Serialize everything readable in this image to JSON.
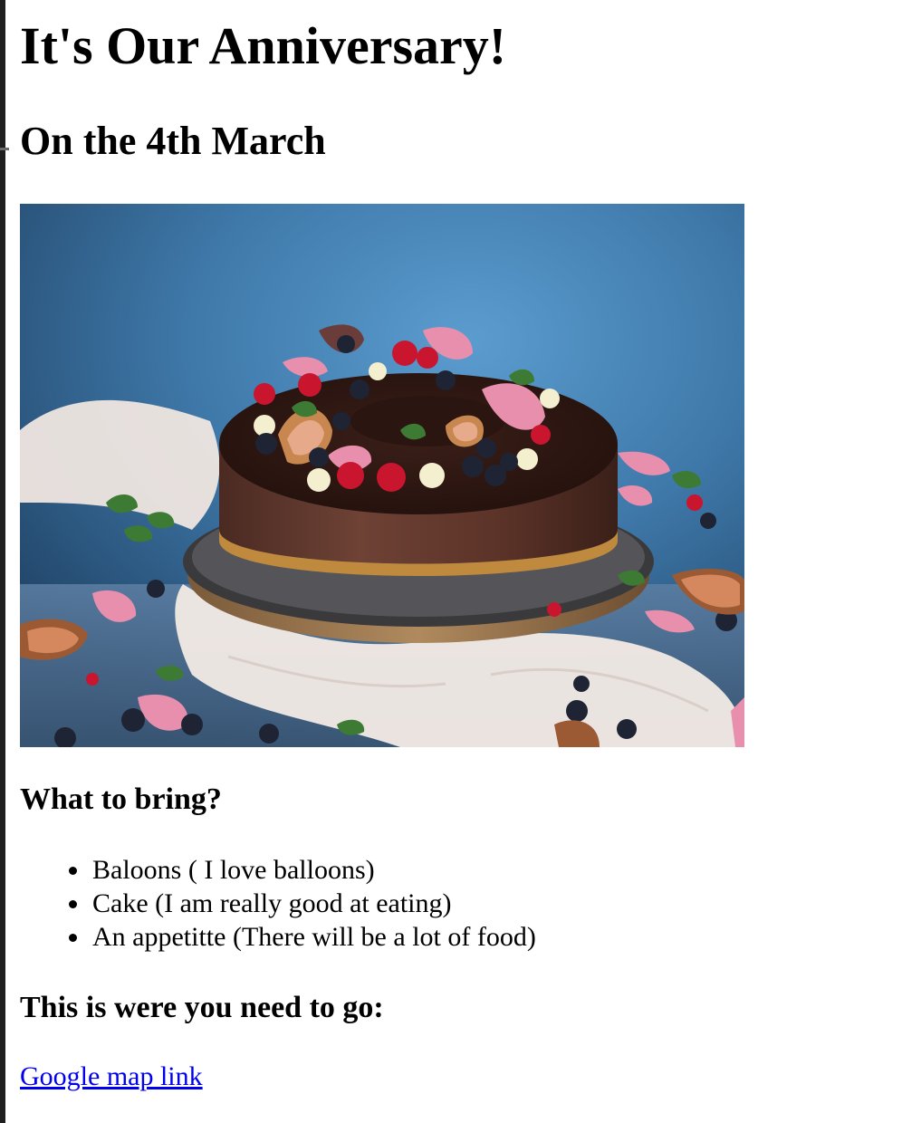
{
  "page": {
    "title": "It's Our Anniversary!",
    "date_heading": "On the 4th March",
    "image": {
      "subject": "chocolate cake decorated with figs, raspberries, blueberries and rose petals"
    },
    "bring": {
      "heading": "What to bring?",
      "items": [
        "Baloons ( I love balloons)",
        "Cake (I am really good at eating)",
        "An appetitte (There will be a lot of food)"
      ]
    },
    "location": {
      "heading": "This is were you need to go:",
      "link_text": "Google map link"
    }
  },
  "colors": {
    "link": "#0000ee",
    "text": "#000000",
    "background": "#ffffff"
  }
}
